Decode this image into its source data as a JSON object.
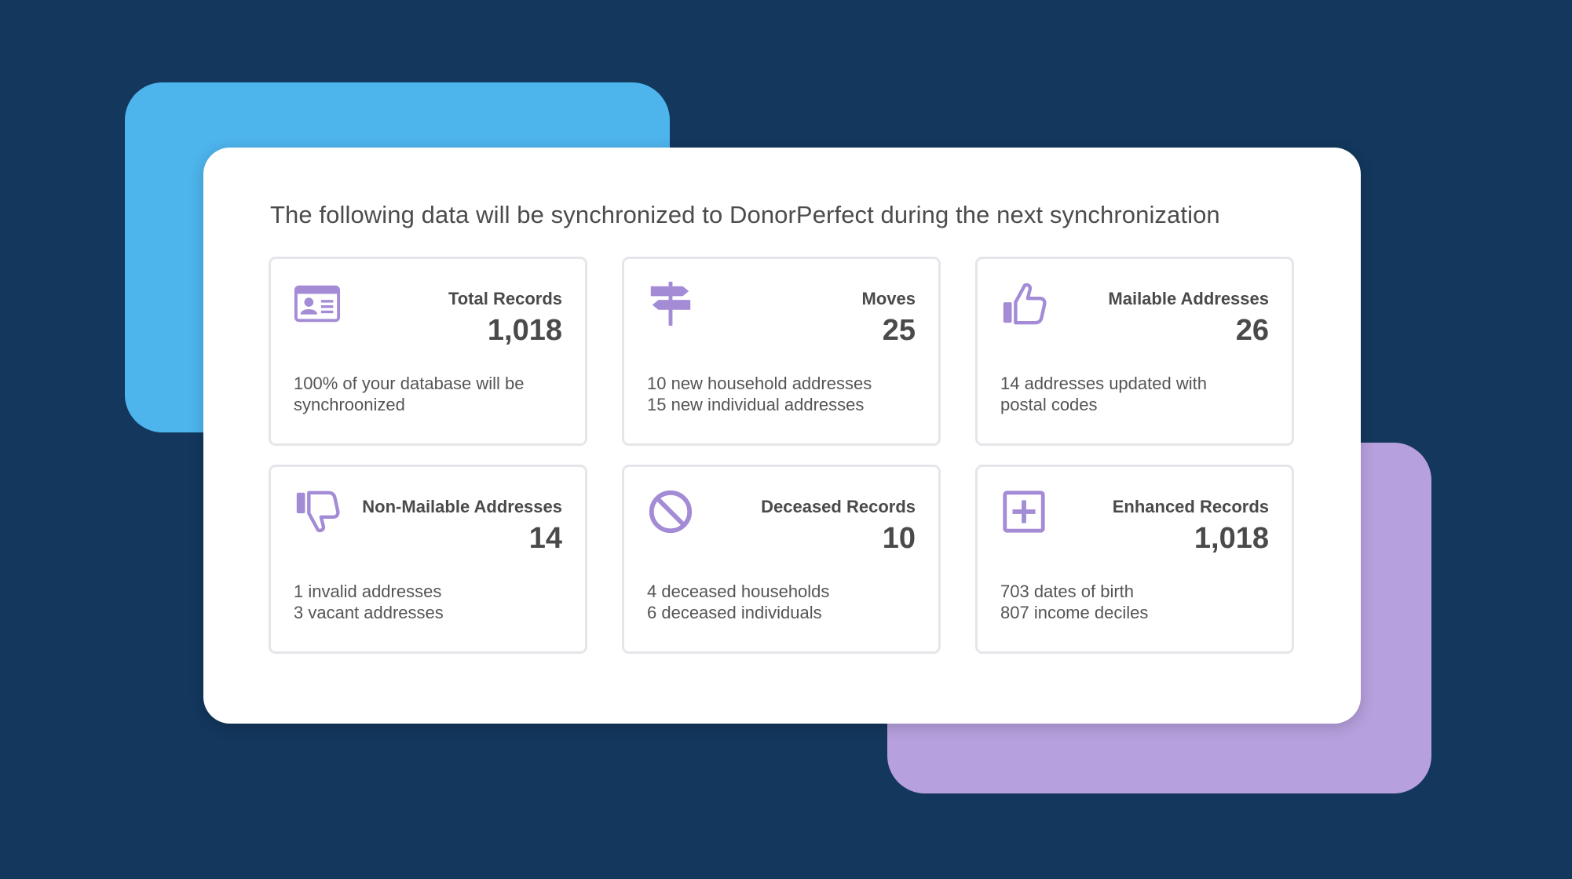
{
  "colors": {
    "background": "#13375d",
    "deco_blue": "#4db4ec",
    "deco_purple": "#b6a0dd",
    "icon": "#a48bd6",
    "text": "#4a4a4a"
  },
  "panel": {
    "title": "The following data will be synchronized to DonorPerfect during the next synchronization"
  },
  "cards": [
    {
      "icon": "id-card-icon",
      "label": "Total Records",
      "value": "1,018",
      "lines": [
        "100% of your database will be",
        "synchroonized"
      ]
    },
    {
      "icon": "signpost-icon",
      "label": "Moves",
      "value": "25",
      "lines": [
        "10 new household addresses",
        "15 new individual addresses"
      ]
    },
    {
      "icon": "thumbs-up-icon",
      "label": "Mailable Addresses",
      "value": "26",
      "lines": [
        "14 addresses updated with",
        "postal codes"
      ]
    },
    {
      "icon": "thumbs-down-icon",
      "label": "Non-Mailable Addresses",
      "value": "14",
      "lines": [
        "1 invalid addresses",
        "3 vacant addresses"
      ]
    },
    {
      "icon": "prohibited-icon",
      "label": "Deceased Records",
      "value": "10",
      "lines": [
        "4 deceased households",
        "6 deceased individuals"
      ]
    },
    {
      "icon": "plus-square-icon",
      "label": "Enhanced Records",
      "value": "1,018",
      "lines": [
        "703 dates of birth",
        "807 income deciles"
      ]
    }
  ]
}
